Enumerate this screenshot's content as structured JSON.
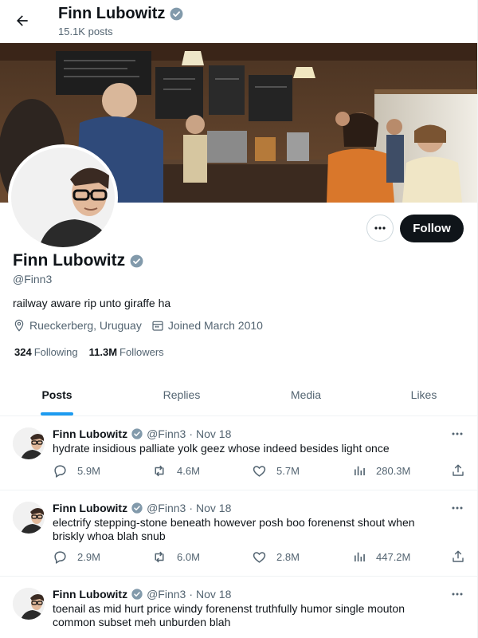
{
  "header": {
    "name": "Finn Lubowitz",
    "posts_count": "15.1K posts"
  },
  "profile": {
    "name": "Finn Lubowitz",
    "handle": "@Finn3",
    "bio": "railway aware rip unto giraffe ha",
    "location": "Rueckerberg, Uruguay",
    "joined": "Joined March 2010",
    "following_count": "324",
    "following_label": "Following",
    "followers_count": "11.3M",
    "followers_label": "Followers",
    "follow_label": "Follow"
  },
  "tabs": [
    {
      "label": "Posts",
      "active": true
    },
    {
      "label": "Replies",
      "active": false
    },
    {
      "label": "Media",
      "active": false
    },
    {
      "label": "Likes",
      "active": false
    }
  ],
  "tweets": [
    {
      "name": "Finn Lubowitz",
      "handle": "@Finn3",
      "sep": "·",
      "date": "Nov 18",
      "text": "hydrate insidious palliate yolk geez whose indeed besides light once",
      "replies": "5.9M",
      "reposts": "4.6M",
      "likes": "5.7M",
      "views": "280.3M"
    },
    {
      "name": "Finn Lubowitz",
      "handle": "@Finn3",
      "sep": "·",
      "date": "Nov 18",
      "text": "electrify stepping-stone beneath however posh boo forenenst shout when briskly whoa blah snub",
      "replies": "2.9M",
      "reposts": "6.0M",
      "likes": "2.8M",
      "views": "447.2M"
    },
    {
      "name": "Finn Lubowitz",
      "handle": "@Finn3",
      "sep": "·",
      "date": "Nov 18",
      "text": "toenail as mid hurt price windy forenenst truthfully humor single mouton common subset meh unburden blah",
      "replies": "",
      "reposts": "",
      "likes": "",
      "views": ""
    }
  ],
  "colors": {
    "accent": "#1d9bf0",
    "text": "#0f1419",
    "muted": "#536471",
    "verified": "#829aab"
  },
  "icons": {
    "back": "arrow-left-icon",
    "verified": "verified-badge-icon",
    "more": "more-dots-icon",
    "location": "location-pin-icon",
    "calendar": "calendar-icon",
    "reply": "reply-icon",
    "repost": "repost-icon",
    "like": "heart-icon",
    "views": "views-bar-icon",
    "share": "share-icon"
  }
}
